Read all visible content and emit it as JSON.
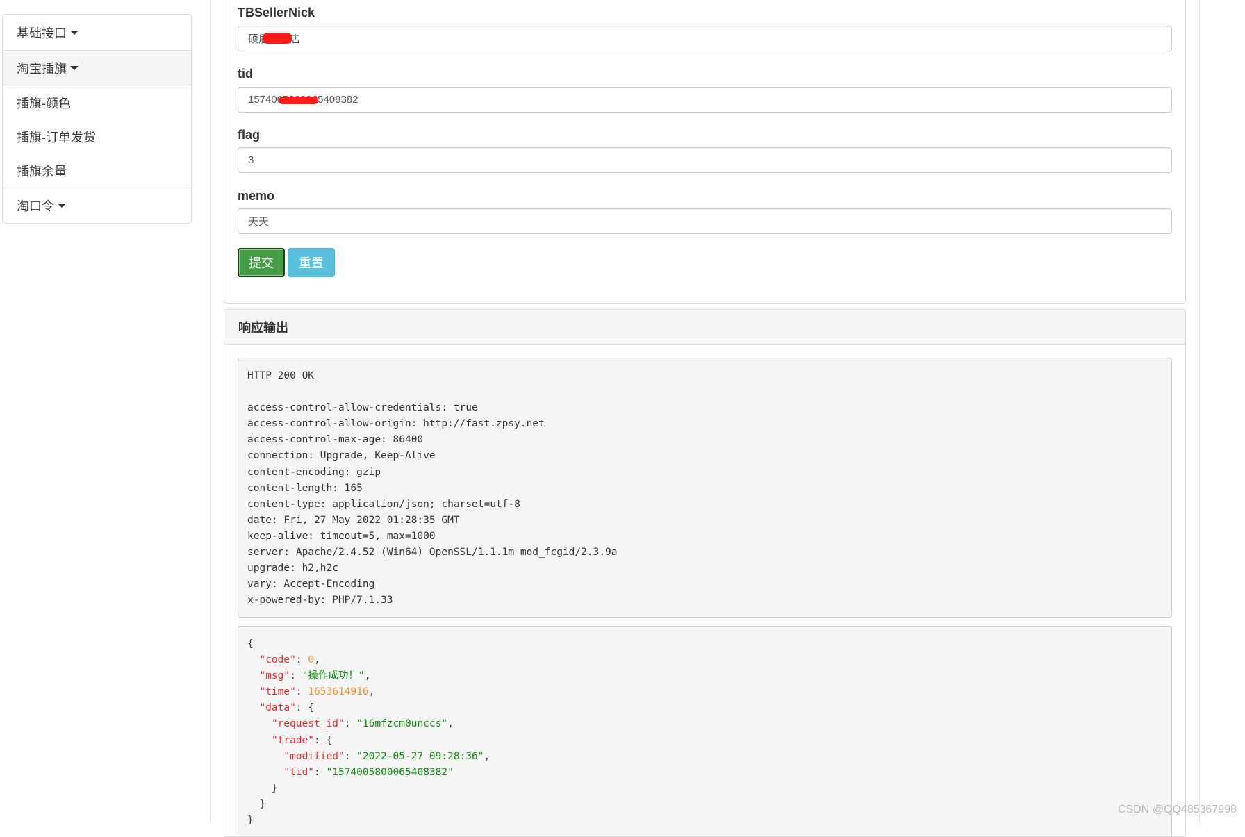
{
  "sidebar": {
    "groups": [
      {
        "label": "基础接口"
      },
      {
        "label": "淘宝插旗",
        "active": true,
        "items": [
          {
            "label": "插旗-颜色"
          },
          {
            "label": "插旗-订单发货"
          },
          {
            "label": "插旗余量"
          }
        ]
      },
      {
        "label": "淘口令"
      }
    ]
  },
  "form": {
    "fields": [
      {
        "label": "TBSellerNick",
        "value": "硕盾专营店"
      },
      {
        "label": "tid",
        "value": "1574005800065408382"
      },
      {
        "label": "flag",
        "value": "3"
      },
      {
        "label": "memo",
        "value": "天天"
      }
    ],
    "submit_label": "提交",
    "reset_label": "重置"
  },
  "response": {
    "title": "响应输出",
    "status_line": "HTTP 200 OK",
    "headers": [
      "access-control-allow-credentials: true",
      "access-control-allow-origin: http://fast.zpsy.net",
      "access-control-max-age: 86400",
      "connection: Upgrade, Keep-Alive",
      "content-encoding: gzip",
      "content-length: 165",
      "content-type: application/json; charset=utf-8",
      "date: Fri, 27 May 2022 01:28:35 GMT",
      "keep-alive: timeout=5, max=1000",
      "server: Apache/2.4.52 (Win64) OpenSSL/1.1.1m mod_fcgid/2.3.9a",
      "upgrade: h2,h2c",
      "vary: Accept-Encoding",
      "x-powered-by: PHP/7.1.33"
    ],
    "json": {
      "code_key": "\"code\"",
      "code_value": "0",
      "msg_key": "\"msg\"",
      "msg_value": "\"操作成功！\"",
      "time_key": "\"time\"",
      "time_value": "1653614916",
      "data_key": "\"data\"",
      "request_id_key": "\"request_id\"",
      "request_id_value": "\"16mfzcm0unccs\"",
      "trade_key": "\"trade\"",
      "modified_key": "\"modified\"",
      "modified_value": "\"2022-05-27 09:28:36\"",
      "tid_key": "\"tid\"",
      "tid_value": "\"1574005800065408382\""
    }
  },
  "watermark": "CSDN @QQ485367998",
  "colors": {
    "submit": "#449d44",
    "reset": "#5bc0de",
    "json_key": "#e8262d",
    "json_string": "#0a8a0a",
    "json_number": "#f0932b"
  }
}
